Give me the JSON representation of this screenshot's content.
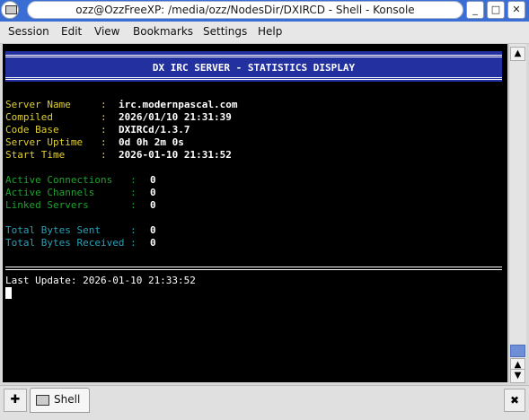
{
  "window": {
    "title": "ozz@OzzFreeXP: /media/ozz/NodesDir/DXIRCD - Shell - Konsole",
    "minimize_glyph": "_",
    "maximize_glyph": "□",
    "close_glyph": "✕"
  },
  "menu": {
    "items": [
      "Session",
      "Edit",
      "View",
      "Bookmarks",
      "Settings",
      "Help"
    ]
  },
  "terminal": {
    "banner": "DX IRC SERVER - STATISTICS DISPLAY",
    "info": [
      {
        "label": "Server Name     :",
        "value": "irc.modernpascal.com"
      },
      {
        "label": "Compiled        :",
        "value": "2026/01/10 21:31:39"
      },
      {
        "label": "Code Base       :",
        "value": "DXIRCd/1.3.7"
      },
      {
        "label": "Server Uptime   :",
        "value": "0d 0h 2m 0s"
      },
      {
        "label": "Start Time      :",
        "value": "2026-01-10 21:31:52"
      }
    ],
    "connections": [
      {
        "label": "Active Connections   :",
        "value": "0"
      },
      {
        "label": "Active Channels      :",
        "value": "0"
      },
      {
        "label": "Linked Servers       :",
        "value": "0"
      }
    ],
    "bytes": [
      {
        "label": "Total Bytes Sent     :",
        "value": "0"
      },
      {
        "label": "Total Bytes Received :",
        "value": "0"
      }
    ],
    "last_update": "Last Update: 2026-01-10 21:33:52"
  },
  "scrollbar": {
    "up_glyph": "▲",
    "down_glyph": "▼"
  },
  "tabs": {
    "new_tab_glyph": "✚",
    "items": [
      {
        "label": "Shell"
      }
    ],
    "close_glyph": "✖"
  },
  "colors": {
    "titlebar": "#3a6ed4",
    "banner": "#2230a0",
    "label_yellow": "#e0d030",
    "label_green": "#20a030",
    "label_cyan": "#2aa0b8"
  }
}
